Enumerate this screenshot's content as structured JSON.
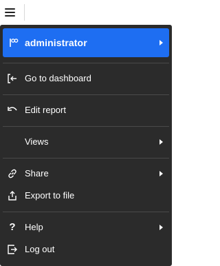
{
  "topbar": {
    "menu_icon": "hamburger-icon"
  },
  "menu": {
    "user": {
      "icon": "flag-icon",
      "label": "administrator",
      "has_submenu": true
    },
    "items": [
      {
        "icon": "login-arrow-icon",
        "label": "Go to dashboard",
        "has_submenu": false
      },
      {
        "icon": "undo-arrow-icon",
        "label": "Edit report",
        "has_submenu": false
      },
      {
        "icon": "",
        "label": "Views",
        "has_submenu": true
      },
      {
        "icon": "link-icon",
        "label": "Share",
        "has_submenu": true
      },
      {
        "icon": "export-icon",
        "label": "Export to file",
        "has_submenu": false
      },
      {
        "icon": "question-icon",
        "label": "Help",
        "has_submenu": true
      },
      {
        "icon": "logout-icon",
        "label": "Log out",
        "has_submenu": false
      }
    ]
  },
  "colors": {
    "menu_background": "#2b2b2b",
    "highlight": "#1e6ef2",
    "divider": "#4a4a4a",
    "text": "#ffffff"
  }
}
